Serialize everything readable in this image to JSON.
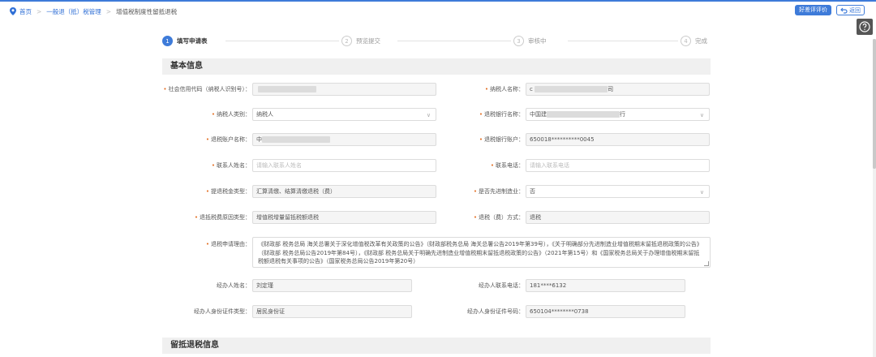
{
  "breadcrumb": {
    "home": "首页",
    "level1": "一般退（抵）税管理",
    "current": "增值税制度性留抵退税"
  },
  "toolbar": {
    "eval_label": "好差评评价",
    "back_label": "返回"
  },
  "icons": {
    "home": "location-pin-icon",
    "back": "return-arrow-icon",
    "help": "question-mark-icon"
  },
  "colors": {
    "accent": "#3e7bd9",
    "required": "#e26b1e"
  },
  "steps": [
    {
      "num": "1",
      "label": "填写申请表"
    },
    {
      "num": "2",
      "label": "预览提交"
    },
    {
      "num": "3",
      "label": "审核中"
    },
    {
      "num": "4",
      "label": "完成"
    }
  ],
  "sections": {
    "basic": "基本信息",
    "refund": "留抵退税信息"
  },
  "form": {
    "credit_code": {
      "label": "社会信用代码（纳税人识别号）：",
      "value": ""
    },
    "taxpayer_name": {
      "label": "纳税人名称：",
      "prefix": "c",
      "suffix": "司"
    },
    "taxpayer_type": {
      "label": "纳税人类别：",
      "value": "纳税人"
    },
    "bank_name": {
      "label": "退税银行名称：",
      "prefix": "中国建",
      "suffix": "行"
    },
    "account_name": {
      "label": "退税账户名称：",
      "prefix": "中"
    },
    "bank_account": {
      "label": "退税银行账户：",
      "value": "650018**********0045"
    },
    "contact_name": {
      "label": "联系人姓名：",
      "placeholder": "请输入联系人姓名"
    },
    "contact_phone": {
      "label": "联系电话：",
      "placeholder": "请输入联系电话"
    },
    "refund_type": {
      "label": "提退税金类型：",
      "value": "汇算清缴、结算清缴退税（费）"
    },
    "advanced_mfg": {
      "label": "是否先进制造业：",
      "value": "否"
    },
    "reason_type": {
      "label": "退抵税费原因类型：",
      "value": "增值税增量留抵税额退税"
    },
    "refund_method": {
      "label": "退税（费）方式：",
      "value": "退税"
    },
    "reason": {
      "label": "退税申请理由：",
      "value": "《财政部 税务总局 海关总署关于深化增值税改革有关政策的公告》（财政部税务总局 海关总署公告2019年第39号），《关于明确部分先进制造业增值税期末留抵退税政策的公告》（财政部 税务总局公告2019年第84号），《财政部 税务总局关于明确先进制造业增值税期末留抵退税政策的公告》（2021年第15号）和《国家税务总局关于办理增值税期末留抵税额退税有关事项的公告》（国家税务总局公告2019年第20号）"
    },
    "agent_name": {
      "label": "经办人姓名：",
      "value": "刘定瑾"
    },
    "agent_phone": {
      "label": "经办人联系电话：",
      "value": "181****6132"
    },
    "agent_id_type": {
      "label": "经办人身份证件类型：",
      "value": "居民身份证"
    },
    "agent_id_no": {
      "label": "经办人身份证件号码：",
      "value": "650104********0738"
    }
  }
}
